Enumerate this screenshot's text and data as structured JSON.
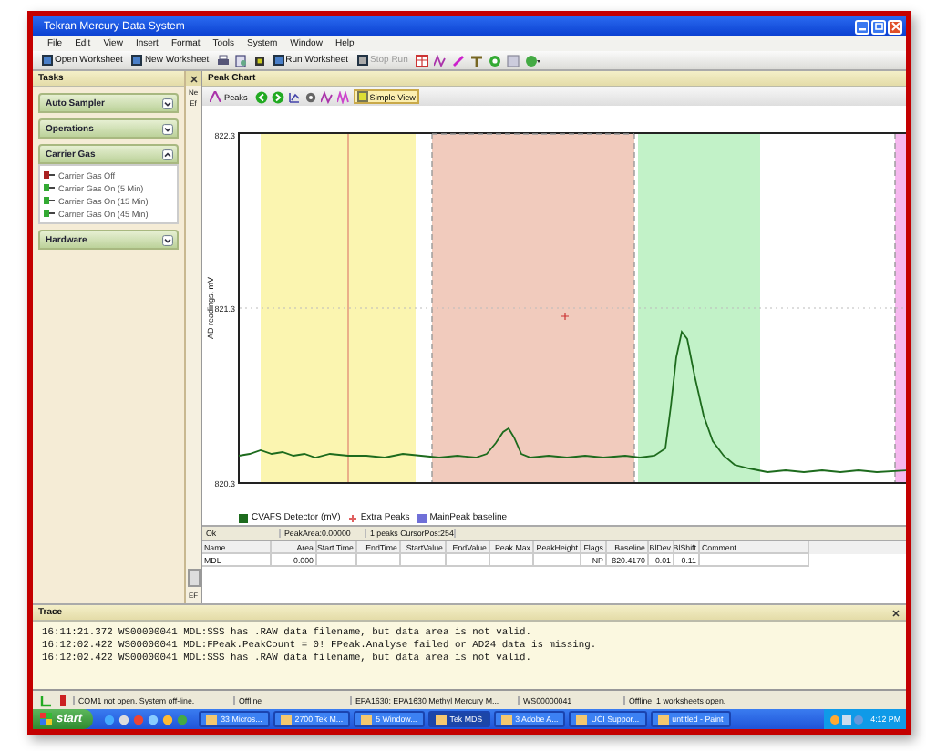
{
  "window": {
    "title": "Tekran Mercury Data System"
  },
  "menu": [
    "File",
    "Edit",
    "View",
    "Insert",
    "Format",
    "Tools",
    "System",
    "Window",
    "Help"
  ],
  "toolbar": [
    {
      "label": "Open Worksheet",
      "disabled": false
    },
    {
      "label": "New Worksheet",
      "disabled": false
    },
    {
      "label": "Run Worksheet",
      "disabled": false
    },
    {
      "label": "Stop Run",
      "disabled": true
    }
  ],
  "tasks": {
    "title": "Tasks",
    "groups": [
      {
        "title": "Auto Sampler",
        "expanded": false
      },
      {
        "title": "Operations",
        "expanded": false
      },
      {
        "title": "Carrier Gas",
        "expanded": true,
        "items": [
          "Carrier Gas Off",
          "Carrier Gas On (5 Min)",
          "Carrier Gas On (15 Min)",
          "Carrier Gas On (45 Min)"
        ]
      },
      {
        "title": "Hardware",
        "expanded": false
      }
    ]
  },
  "side_strip": {
    "labels": [
      "Ne",
      "Ef"
    ],
    "bottom_label": "EF"
  },
  "peak_chart": {
    "title": "Peak Chart",
    "peaks_button": "Peaks",
    "simple_view": {
      "label": "Simple View",
      "pressed": true
    },
    "chart": {
      "ylabel": "AD readings, mV",
      "yticks": [
        "822.3",
        "821.3",
        "820.3"
      ]
    },
    "legend": [
      {
        "label": "CVAFS Detector (mV)",
        "color": "#1d6b1d"
      },
      {
        "label": "Extra Peaks",
        "color": "#e06060"
      },
      {
        "label": "MainPeak baseline",
        "color": "#7070d8"
      }
    ],
    "status": [
      "Ok",
      "PeakArea:0.00000",
      "1 peaks CursorPos:254"
    ],
    "table": {
      "columns": [
        "Name",
        "Area",
        "Start Time",
        "EndTime",
        "StartValue",
        "EndValue",
        "Peak Max",
        "PeakHeight",
        "Flags",
        "Baseline",
        "BlDev",
        "BlShift",
        "Comment"
      ],
      "rows": [
        [
          "MDL",
          "0.000",
          "-",
          "-",
          "-",
          "-",
          "-",
          "-",
          "NP",
          "820.4170",
          "0.01",
          "-0.11"
        ]
      ]
    }
  },
  "trace": {
    "title": "Trace",
    "lines": [
      "16:11:21.372 WS00000041 MDL:SSS has .RAW data filename, but data area is not valid.",
      "16:12:02.422 WS00000041 MDL:FPeak.PeakCount = 0! FPeak.Analyse failed or AD24 data is missing.",
      "16:12:02.422 WS00000041 MDL:SSS has .RAW data filename, but data area is not valid."
    ]
  },
  "status_bar": [
    "COM1 not open. System off-line.",
    "Offline",
    "EPA1630: EPA1630 Methyl Mercury M...",
    "WS00000041",
    "Offline.  1 worksheets open."
  ],
  "taskbar": {
    "start": "start",
    "tasks": [
      {
        "label": "33 Micros...",
        "selected": false
      },
      {
        "label": "2700 Tek M...",
        "selected": false
      },
      {
        "label": "5 Window...",
        "selected": false
      },
      {
        "label": "Tek MDS",
        "selected": true
      },
      {
        "label": "3 Adobe A...",
        "selected": false
      },
      {
        "label": "UCI Suppor...",
        "selected": false
      },
      {
        "label": "untitled - Paint",
        "selected": false
      }
    ],
    "clock": "4:12 PM"
  }
}
